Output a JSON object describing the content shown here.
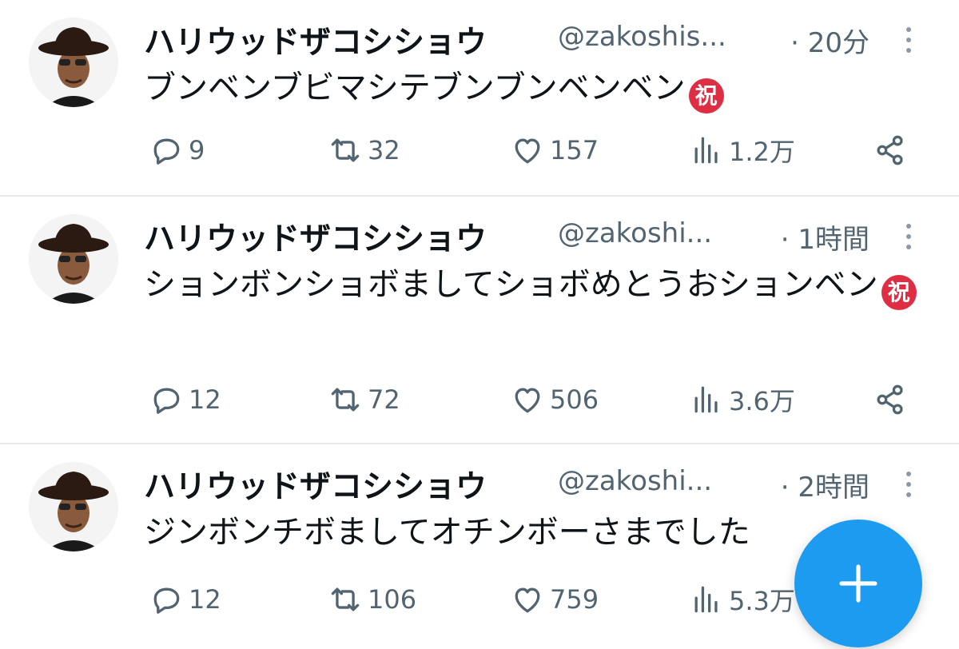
{
  "colors": {
    "accent": "#1d9bf0",
    "text": "#0f1419",
    "muted": "#536471",
    "divider": "#e6e9ec",
    "emoji_red": "#dd2e44"
  },
  "compose_button": {
    "icon": "plus-icon"
  },
  "tweets": [
    {
      "name": "ハリウッドザコシショウ",
      "handle": "@zakoshis...",
      "time": "· 20分",
      "text": "ブンベンブビマシテブンブンベンベン",
      "emoji": "祝",
      "replies": "9",
      "retweets": "32",
      "likes": "157",
      "views": "1.2万"
    },
    {
      "name": "ハリウッドザコシショウ",
      "handle": "@zakoshi...",
      "time": "· 1時間",
      "text": "ションボンショボましてショボめとうおションベン",
      "emoji": "祝",
      "replies": "12",
      "retweets": "72",
      "likes": "506",
      "views": "3.6万"
    },
    {
      "name": "ハリウッドザコシショウ",
      "handle": "@zakoshi...",
      "time": "· 2時間",
      "text": "ジンボンチボましてオチンボーさまでした",
      "emoji": "",
      "replies": "12",
      "retweets": "106",
      "likes": "759",
      "views": "5.3万"
    }
  ]
}
